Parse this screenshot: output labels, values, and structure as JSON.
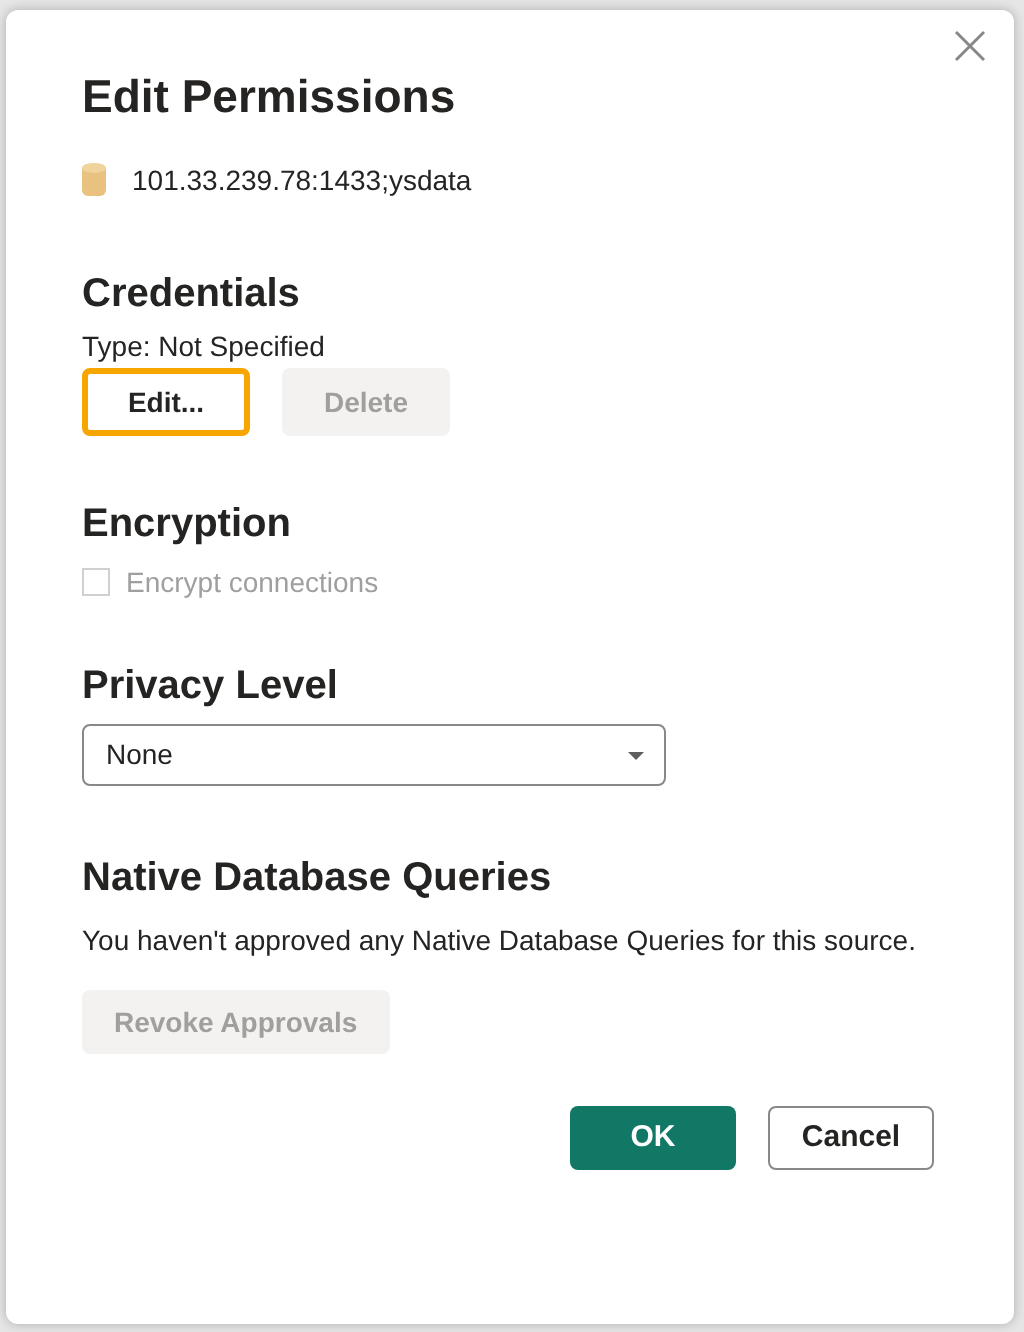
{
  "dialog": {
    "title": "Edit Permissions",
    "source": "101.33.239.78:1433;ysdata"
  },
  "credentials": {
    "heading": "Credentials",
    "type_text": "Type: Not Specified",
    "buttons": [
      {
        "label": "Edit...",
        "disabled": false,
        "focused": true
      },
      {
        "label": "Delete",
        "disabled": true,
        "focused": false
      }
    ]
  },
  "encryption": {
    "heading": "Encryption",
    "checkbox": {
      "label": "Encrypt connections",
      "checked": false,
      "disabled": true
    }
  },
  "privacy": {
    "heading": "Privacy Level",
    "dropdown": {
      "value": "None"
    }
  },
  "native_queries": {
    "heading": "Native Database Queries",
    "text": "You haven't approved any Native Database Queries for this source.",
    "button": {
      "label": "Revoke Approvals",
      "disabled": true
    }
  },
  "footer_buttons": [
    {
      "label": "OK",
      "primary": true
    },
    {
      "label": "Cancel",
      "primary": false
    }
  ]
}
